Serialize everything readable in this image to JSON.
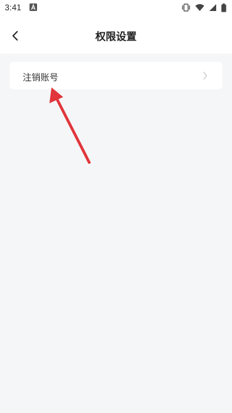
{
  "status_bar": {
    "time": "3:41",
    "app_icon": "font-a-icon",
    "right_icons": [
      "vibrate-icon",
      "wifi-icon",
      "signal-icon",
      "battery-icon"
    ]
  },
  "header": {
    "title": "权限设置",
    "back_icon": "chevron-left-icon"
  },
  "settings": {
    "items": [
      {
        "label": "注销账号",
        "icon": "chevron-right-icon"
      }
    ]
  },
  "annotation": {
    "arrow_color": "#e0353a"
  }
}
